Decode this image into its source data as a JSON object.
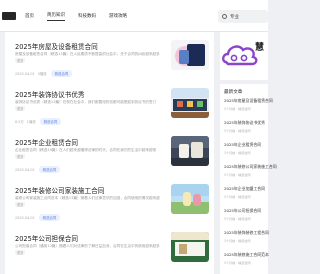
{
  "header": {
    "nav": [
      "首页",
      "简历知识",
      "科技数码",
      "游戏攻略"
    ],
    "search_text": "专业"
  },
  "articles": [
    {
      "title": "2025年房屋及设备租赁合同",
      "summary": "房屋及设备租赁合同（精选13篇）在人民素质不断提高的社会中，关于合同的纠纷越来越多",
      "more": "更多",
      "date": "2025-04-01",
      "views": "3播放",
      "tag": "精选合同"
    },
    {
      "title": "2025年装饰协议书优秀",
      "summary": "装饰协议书优秀（精选13篇）在现在社会中，我们都要用的也都可能是能到协议书的签订",
      "more": "更多",
      "date": "8.5万",
      "views": "1播放",
      "tag": "精选合同"
    },
    {
      "title": "2025年企业租赁合同",
      "summary": "企业租赁合同（精选19篇）在人们越来越懂得法律的时代，合同在我们的生活中越来越常",
      "more": "更多",
      "date": "2025-04-01",
      "views": "",
      "tag": "精选合同"
    },
    {
      "title": "2025年装修公司家装施工合同",
      "summary": "装修公司家装施工合同范本（精选13篇）随着人们法律意识的加强，合同使用的情况越来越",
      "more": "更多",
      "date": "2025-04-01",
      "views": "",
      "tag": "精选合同"
    },
    {
      "title": "2025年公司担保合同",
      "summary": "公司担保合同（通用13篇）随着人们对法律的了解日益加深，合同在生活中的使用越来越多",
      "more": "更多",
      "date": "",
      "views": "",
      "tag": ""
    }
  ],
  "sidebar": {
    "brand": "慧",
    "title": "最新文章",
    "items": [
      {
        "title": "2025年房屋及设备租赁合同",
        "sub": "3个月前 · 精选合同"
      },
      {
        "title": "2025年装饰协议书优秀",
        "sub": "3个月前 · 精选合同"
      },
      {
        "title": "2025年企业租赁合同",
        "sub": "3个月前 · 精选合同"
      },
      {
        "title": "2025年装修公司家装施工合同",
        "sub": "3个月前 · 精选合同"
      },
      {
        "title": "2025年企业加盟工合同",
        "sub": "3个月前 · 精选合同"
      },
      {
        "title": "2025年公司担保合同",
        "sub": "3个月前 · 精选合同"
      },
      {
        "title": "2025年装饰装修工程合同",
        "sub": "3个月前 · 精选合同"
      },
      {
        "title": "2025年装修施工合同范本",
        "sub": "3个月前 · 精选合同"
      }
    ]
  },
  "colors": {
    "accent": "#5f7fdc",
    "tag_bg": "#eaf0fd",
    "brand_purple": "#8a45c8"
  }
}
